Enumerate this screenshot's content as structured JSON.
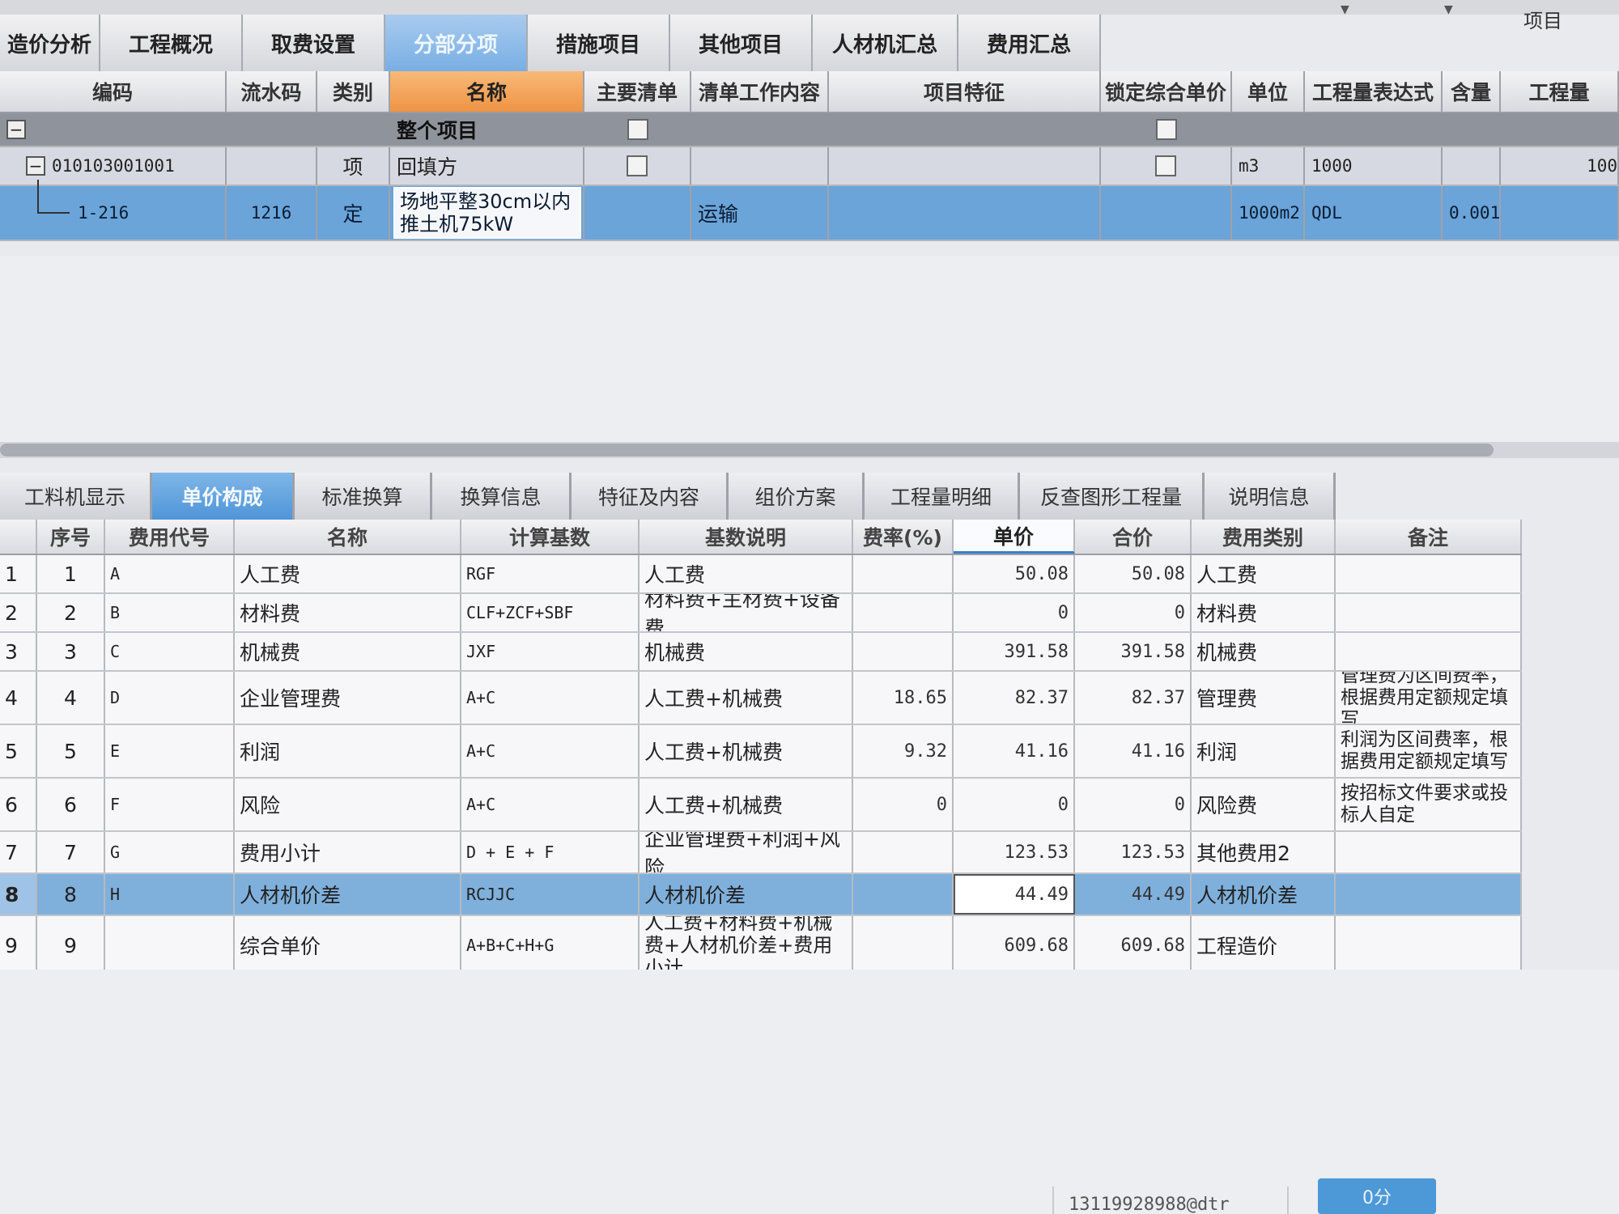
{
  "top": {
    "right_label": "项目"
  },
  "main_tabs": [
    {
      "label": "造价分析",
      "active": false
    },
    {
      "label": "工程概况",
      "active": false
    },
    {
      "label": "取费设置",
      "active": false
    },
    {
      "label": "分部分项",
      "active": true
    },
    {
      "label": "措施项目",
      "active": false
    },
    {
      "label": "其他项目",
      "active": false
    },
    {
      "label": "人材机汇总",
      "active": false
    },
    {
      "label": "费用汇总",
      "active": false
    }
  ],
  "upper_grid": {
    "headers": [
      "编码",
      "流水码",
      "类别",
      "名称",
      "主要清单",
      "清单工作内容",
      "项目特征",
      "锁定综合单价",
      "单位",
      "工程量表达式",
      "含量",
      "工程量"
    ],
    "rows": [
      {
        "code": "",
        "serial": "",
        "type": "",
        "name": "整个项目",
        "main_list": false,
        "work_content": "",
        "feature": "",
        "locked": false,
        "unit": "",
        "expr": "",
        "content_qty": "",
        "qty": ""
      },
      {
        "code": "010103001001",
        "serial": "",
        "type": "项",
        "name": "回填方",
        "main_list": false,
        "work_content": "",
        "feature": "",
        "locked": false,
        "unit": "m3",
        "expr": "1000",
        "content_qty": "",
        "qty": "100"
      },
      {
        "code": "1-216",
        "serial": "1216",
        "type": "定",
        "name_line1": "场地平整30cm以内",
        "name_line2": "推土机75kW",
        "work_content": "运输",
        "feature": "",
        "unit": "1000m2",
        "expr": "QDL",
        "content_qty": "0.001",
        "qty": ""
      }
    ]
  },
  "lower_tabs": [
    {
      "label": "工料机显示",
      "active": false
    },
    {
      "label": "单价构成",
      "active": true
    },
    {
      "label": "标准换算",
      "active": false
    },
    {
      "label": "换算信息",
      "active": false
    },
    {
      "label": "特征及内容",
      "active": false
    },
    {
      "label": "组价方案",
      "active": false
    },
    {
      "label": "工程量明细",
      "active": false
    },
    {
      "label": "反查图形工程量",
      "active": false
    },
    {
      "label": "说明信息",
      "active": false
    }
  ],
  "lower_grid": {
    "headers": [
      "序号",
      "费用代号",
      "名称",
      "计算基数",
      "基数说明",
      "费率(%)",
      "单价",
      "合价",
      "费用类别",
      "备注"
    ],
    "rows": [
      {
        "idx": "1",
        "seq": "1",
        "code": "A",
        "name": "人工费",
        "base": "RGF",
        "desc": "人工费",
        "rate": "",
        "price": "50.08",
        "total": "50.08",
        "cat": "人工费",
        "remark": ""
      },
      {
        "idx": "2",
        "seq": "2",
        "code": "B",
        "name": "材料费",
        "base": "CLF+ZCF+SBF",
        "desc": "材料费+主材费+设备费",
        "rate": "",
        "price": "0",
        "total": "0",
        "cat": "材料费",
        "remark": ""
      },
      {
        "idx": "3",
        "seq": "3",
        "code": "C",
        "name": "机械费",
        "base": "JXF",
        "desc": "机械费",
        "rate": "",
        "price": "391.58",
        "total": "391.58",
        "cat": "机械费",
        "remark": ""
      },
      {
        "idx": "4",
        "seq": "4",
        "code": "D",
        "name": "企业管理费",
        "base": "A+C",
        "desc": "人工费+机械费",
        "rate": "18.65",
        "price": "82.37",
        "total": "82.37",
        "cat": "管理费",
        "remark": "管理费为区间费率，根据费用定额规定填写"
      },
      {
        "idx": "5",
        "seq": "5",
        "code": "E",
        "name": "利润",
        "base": "A+C",
        "desc": "人工费+机械费",
        "rate": "9.32",
        "price": "41.16",
        "total": "41.16",
        "cat": "利润",
        "remark": "利润为区间费率，根据费用定额规定填写"
      },
      {
        "idx": "6",
        "seq": "6",
        "code": "F",
        "name": "风险",
        "base": "A+C",
        "desc": "人工费+机械费",
        "rate": "0",
        "price": "0",
        "total": "0",
        "cat": "风险费",
        "remark": "按招标文件要求或投标人自定"
      },
      {
        "idx": "7",
        "seq": "7",
        "code": "G",
        "name": "费用小计",
        "base": "D + E + F",
        "desc": "企业管理费+利润+风险",
        "rate": "",
        "price": "123.53",
        "total": "123.53",
        "cat": "其他费用2",
        "remark": ""
      },
      {
        "idx": "8",
        "seq": "8",
        "code": "H",
        "name": "人材机价差",
        "base": "RCJJC",
        "desc": "人材机价差",
        "rate": "",
        "price": "44.49",
        "total": "44.49",
        "cat": "人材机价差",
        "remark": ""
      },
      {
        "idx": "9",
        "seq": "9",
        "code": "",
        "name": "综合单价",
        "base": "A+B+C+H+G",
        "desc": "人工费+材料费+机械费+人材机价差+费用小计",
        "rate": "",
        "price": "609.68",
        "total": "609.68",
        "cat": "工程造价",
        "remark": ""
      }
    ]
  },
  "footer": {
    "account_text": "13119928988@dtr",
    "button_label": "0分"
  }
}
